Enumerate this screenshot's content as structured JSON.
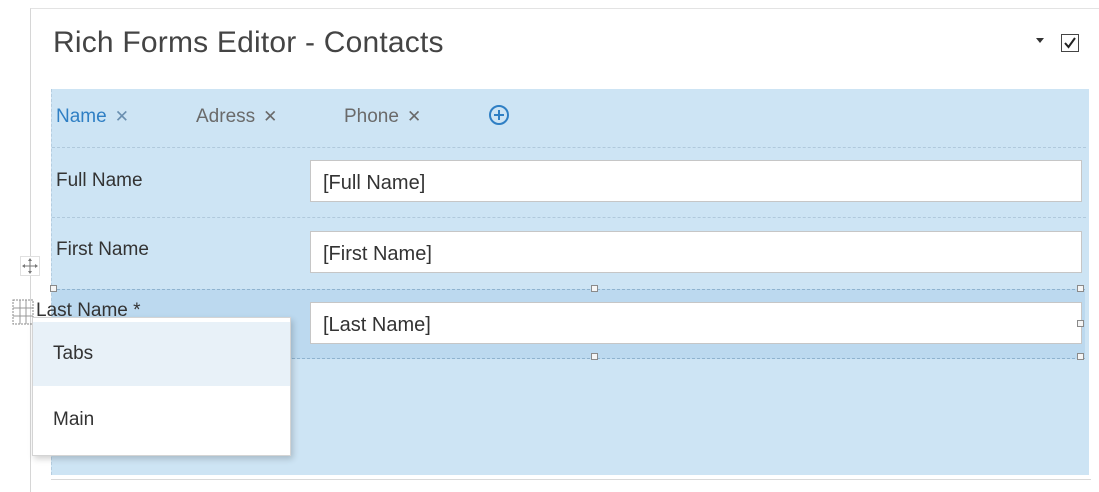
{
  "editor": {
    "title": "Rich Forms Editor - Contacts",
    "checkbox_checked": true
  },
  "tabs": [
    {
      "label": "Name",
      "active": true,
      "close_icon": "close-icon"
    },
    {
      "label": "Adress",
      "active": false,
      "close_icon": "close-icon"
    },
    {
      "label": "Phone",
      "active": false,
      "close_icon": "close-icon"
    }
  ],
  "add_tab_icon": "plus-circle-icon",
  "fields": [
    {
      "label": "Full Name",
      "value": "[Full Name]"
    },
    {
      "label": "First Name",
      "value": "[First Name]"
    },
    {
      "label": "Last Name *",
      "value": "[Last Name]"
    }
  ],
  "context_menu": {
    "items": [
      {
        "label": "Tabs"
      },
      {
        "label": "Main"
      }
    ]
  },
  "colors": {
    "accent": "#2f7fc4",
    "canvas": "#cde4f4",
    "selected_row": "#bcd9ef"
  }
}
